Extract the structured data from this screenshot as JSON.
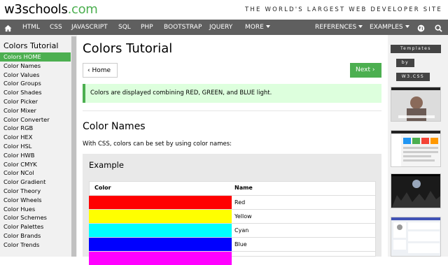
{
  "header": {
    "logo_main": "w3schools",
    "logo_suffix": ".com",
    "tagline": "THE WORLD'S LARGEST WEB DEVELOPER SITE"
  },
  "nav": {
    "items": [
      "HTML",
      "CSS",
      "JAVASCRIPT",
      "SQL",
      "PHP",
      "BOOTSTRAP",
      "JQUERY",
      "MORE"
    ],
    "right_items": [
      "REFERENCES",
      "EXAMPLES"
    ],
    "icons": [
      "home-icon",
      "globe-icon",
      "search-icon"
    ]
  },
  "sidebar": {
    "title": "Colors Tutorial",
    "items": [
      "Colors HOME",
      "Color Names",
      "Color Values",
      "Color Groups",
      "Color Shades",
      "Color Picker",
      "Color Mixer",
      "Color Converter",
      "Color RGB",
      "Color HEX",
      "Color HSL",
      "Color HWB",
      "Color CMYK",
      "Color NCol",
      "Color Gradient",
      "Color Theory",
      "Color Wheels",
      "Color Hues",
      "Color Schemes",
      "Color Palettes",
      "Color Brands",
      "Color Trends"
    ],
    "active_index": 0
  },
  "main": {
    "title": "Colors Tutorial",
    "home_button": "Home",
    "next_button": "Next",
    "note": "Colors are displayed combining RED, GREEN, and BLUE light.",
    "section_title": "Color Names",
    "intro": "With CSS, colors can be set by using color names:",
    "example_title": "Example",
    "table": {
      "headers": [
        "Color",
        "Name"
      ],
      "rows": [
        {
          "name": "Red",
          "color": "#ff0000"
        },
        {
          "name": "Yellow",
          "color": "#ffff00"
        },
        {
          "name": "Cyan",
          "color": "#00ffff"
        },
        {
          "name": "Blue",
          "color": "#0000ff"
        },
        {
          "name": "",
          "color": "#ff00ff"
        }
      ]
    }
  },
  "right": {
    "template_lines": [
      "Templates",
      "by",
      "W3.CSS"
    ]
  },
  "colors": {
    "accent": "#4CAF50",
    "navbar": "#5f5f5f",
    "note_bg": "#ddffdd",
    "sidebar_bg": "#f1f1f1"
  }
}
